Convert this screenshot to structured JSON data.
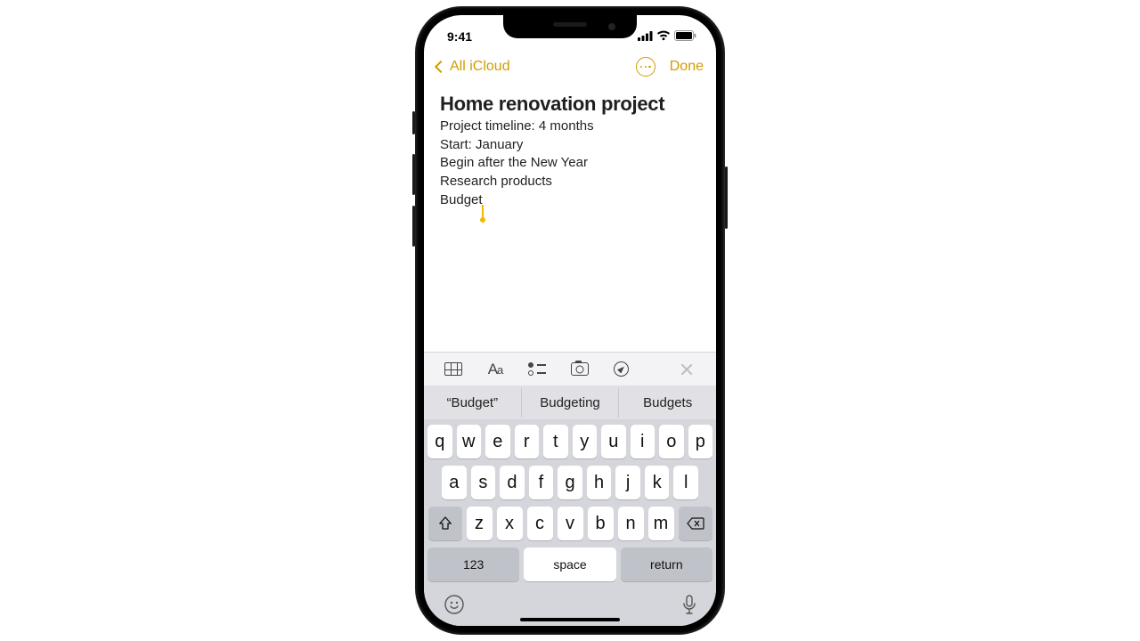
{
  "status": {
    "time": "9:41"
  },
  "nav": {
    "back_label": "All iCloud",
    "done_label": "Done"
  },
  "note": {
    "timestamp": "",
    "title": "Home renovation project",
    "lines": [
      "Project timeline: 4 months",
      "Start: January",
      "Begin after the New Year",
      "Research products"
    ],
    "last_line": "Budget"
  },
  "toolbar": {
    "table_icon": "table-icon",
    "text_format_icon": "Aa",
    "checklist_icon": "checklist-icon",
    "camera_icon": "camera-icon",
    "markup_icon": "markup-icon",
    "close_icon": "close-icon"
  },
  "suggestions": [
    "“Budget”",
    "Budgeting",
    "Budgets"
  ],
  "keyboard": {
    "row1": [
      "q",
      "w",
      "e",
      "r",
      "t",
      "y",
      "u",
      "i",
      "o",
      "p"
    ],
    "row2": [
      "a",
      "s",
      "d",
      "f",
      "g",
      "h",
      "j",
      "k",
      "l"
    ],
    "row3": [
      "z",
      "x",
      "c",
      "v",
      "b",
      "n",
      "m"
    ],
    "numbers_label": "123",
    "space_label": "space",
    "return_label": "return"
  }
}
